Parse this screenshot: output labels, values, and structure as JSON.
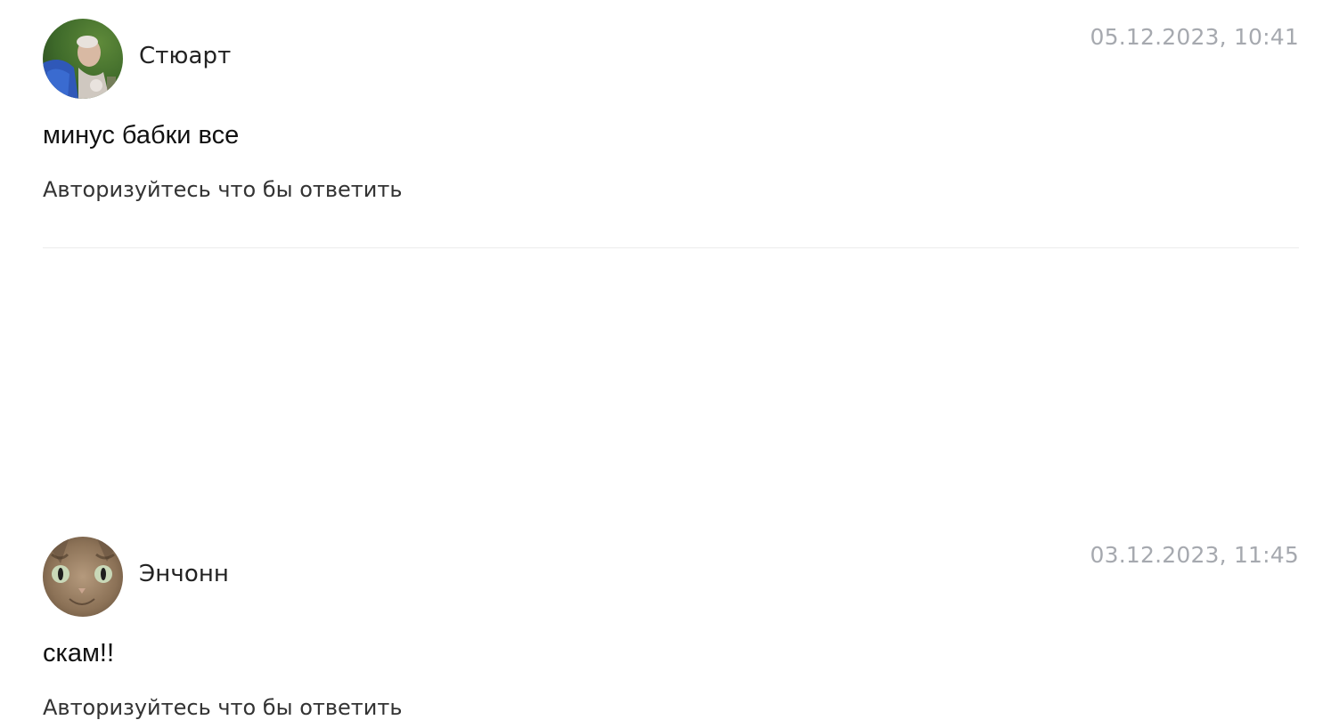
{
  "comments": [
    {
      "author": "Стюарт",
      "date": "05.12.2023, 10:41",
      "text": "минус бабки все",
      "reply_label": "Авторизуйтесь что бы ответить",
      "avatar": "user-photo-avatar"
    },
    {
      "author": "Энчонн",
      "date": "03.12.2023, 11:45",
      "text": "скам!!",
      "reply_label": "Авторизуйтесь что бы ответить",
      "avatar": "cat-photo-avatar"
    }
  ],
  "colors": {
    "author": "#222222",
    "date": "#a6a9af",
    "text": "#111111",
    "reply": "#333333",
    "divider": "#ececec"
  }
}
